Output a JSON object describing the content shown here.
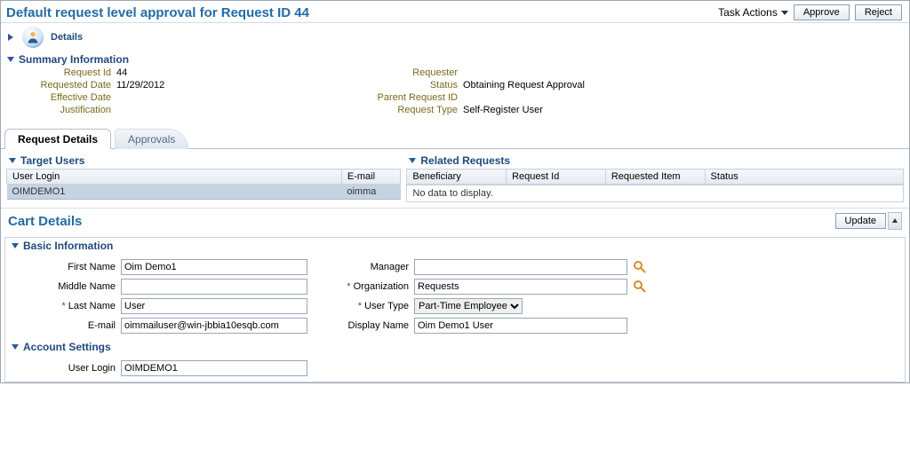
{
  "header": {
    "title": "Default request level approval for Request ID 44",
    "task_actions_label": "Task Actions",
    "approve_label": "Approve",
    "reject_label": "Reject"
  },
  "details": {
    "label": "Details"
  },
  "summary": {
    "heading": "Summary Information",
    "labels": {
      "request_id": "Request Id",
      "requested_date": "Requested Date",
      "effective_date": "Effective Date",
      "justification": "Justification",
      "requester": "Requester",
      "status": "Status",
      "parent_request_id": "Parent Request ID",
      "request_type": "Request Type"
    },
    "values": {
      "request_id": "44",
      "requested_date": "11/29/2012",
      "effective_date": "",
      "justification": "",
      "requester": "",
      "status": "Obtaining Request Approval",
      "parent_request_id": "",
      "request_type": "Self-Register User"
    }
  },
  "tabs": {
    "request_details": "Request Details",
    "approvals": "Approvals"
  },
  "target_users": {
    "heading": "Target Users",
    "cols": {
      "user_login": "User Login",
      "email": "E-mail"
    },
    "rows": [
      {
        "user_login": "OIMDEMO1",
        "email": "oimma"
      }
    ]
  },
  "related_requests": {
    "heading": "Related Requests",
    "cols": {
      "beneficiary": "Beneficiary",
      "request_id": "Request Id",
      "requested_item": "Requested Item",
      "status": "Status"
    },
    "nodata": "No data to display."
  },
  "cart": {
    "title": "Cart Details",
    "update_label": "Update"
  },
  "basic_info": {
    "heading": "Basic Information",
    "labels": {
      "first_name": "First Name",
      "middle_name": "Middle Name",
      "last_name": "Last Name",
      "email": "E-mail",
      "manager": "Manager",
      "organization": "Organization",
      "user_type": "User Type",
      "display_name": "Display Name"
    },
    "values": {
      "first_name": "Oim Demo1",
      "middle_name": "",
      "last_name": "User",
      "email": "oimmailuser@win-jbbia10esqb.com",
      "manager": "",
      "organization": "Requests",
      "user_type": "Part-Time Employee",
      "display_name": "Oim Demo1 User"
    }
  },
  "account_settings": {
    "heading": "Account Settings",
    "labels": {
      "user_login": "User Login"
    },
    "values": {
      "user_login": "OIMDEMO1"
    }
  }
}
